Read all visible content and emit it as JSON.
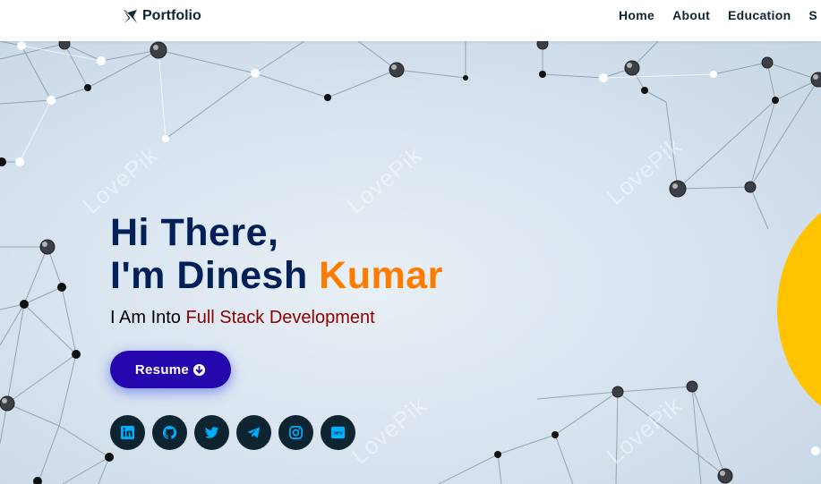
{
  "navbar": {
    "brand": "Portfolio",
    "brand_icon": "origami-crane-icon",
    "links": [
      "Home",
      "About",
      "Education",
      "S"
    ]
  },
  "hero": {
    "greeting": "Hi There,",
    "name_prefix": "I'm Dinesh ",
    "name_accent": "Kumar",
    "tagline_prefix": "I Am Into ",
    "tagline_typed": "Full Stack Development",
    "resume_label": "Resume",
    "resume_icon": "arrow-circle-down-icon",
    "watermark": "LovePik",
    "socials": [
      {
        "name": "linkedin-icon"
      },
      {
        "name": "github-icon"
      },
      {
        "name": "twitter-icon"
      },
      {
        "name": "telegram-icon"
      },
      {
        "name": "instagram-icon"
      },
      {
        "name": "dev-icon",
        "label": "DEV"
      }
    ]
  },
  "colors": {
    "heading": "#002057",
    "accent": "#ff7b00",
    "typed": "#8b0000",
    "button": "#2506ad",
    "social_bg": "#0e2431",
    "social_icon": "#00aeff",
    "blob": "#ffc300"
  }
}
